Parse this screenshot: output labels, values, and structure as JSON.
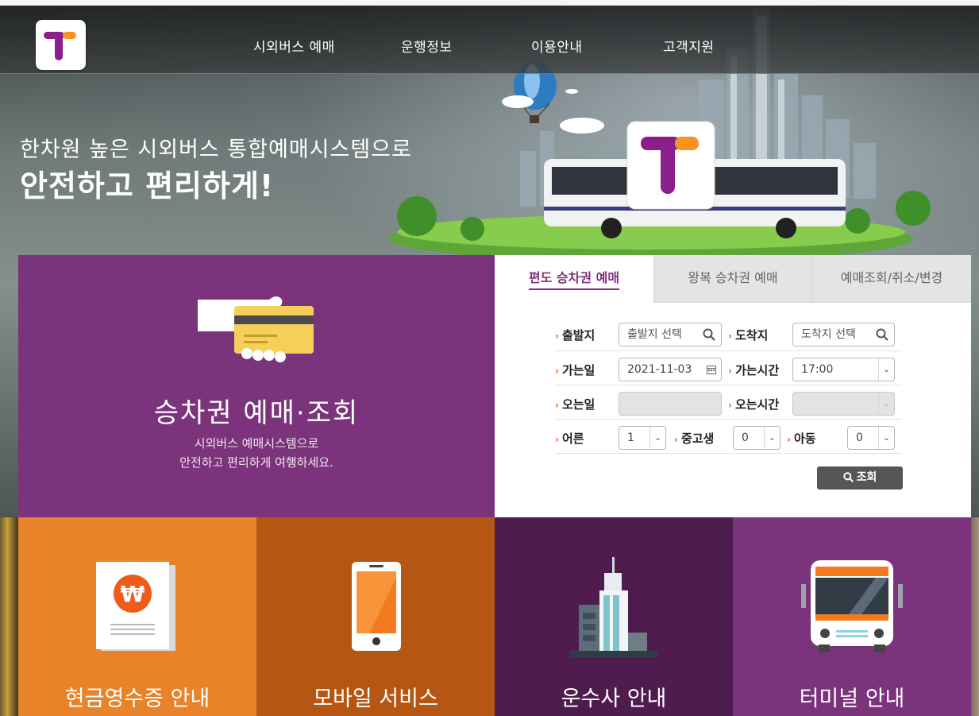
{
  "nav": {
    "items": [
      "시외버스 예매",
      "운행정보",
      "이용안내",
      "고객지원"
    ]
  },
  "hero": {
    "line1": "한차원 높은 시외버스 통합예매시스템으로",
    "line2": "안전하고 편리하게!"
  },
  "card": {
    "title": "승차권 예매·조회",
    "desc1": "시외버스 예매시스템으로",
    "desc2": "안전하고 편리하게 여행하세요."
  },
  "tabs": [
    "편도 승차권 예매",
    "왕복 승차권 예매",
    "예매조회/취소/변경"
  ],
  "form": {
    "depart_label": "출발지",
    "depart_placeholder": "출발지 선택",
    "arrive_label": "도착지",
    "arrive_placeholder": "도착지 선택",
    "go_date_label": "가는일",
    "go_date_value": "2021-11-03",
    "go_time_label": "가는시간",
    "go_time_value": "17:00",
    "return_date_label": "오는일",
    "return_time_label": "오는시간",
    "adult_label": "어른",
    "adult_value": "1",
    "youth_label": "중고생",
    "youth_value": "0",
    "child_label": "아동",
    "child_value": "0",
    "search_button": "조회"
  },
  "tiles": [
    {
      "label": "현금영수증 안내",
      "color": "#e8832a"
    },
    {
      "label": "모바일 서비스",
      "color": "#b55612"
    },
    {
      "label": "운수사 안내",
      "color": "#4e1d4e"
    },
    {
      "label": "터미널 안내",
      "color": "#7b337b"
    }
  ],
  "colors": {
    "brand_purple": "#7b337b",
    "accent_orange": "#f7941d"
  }
}
